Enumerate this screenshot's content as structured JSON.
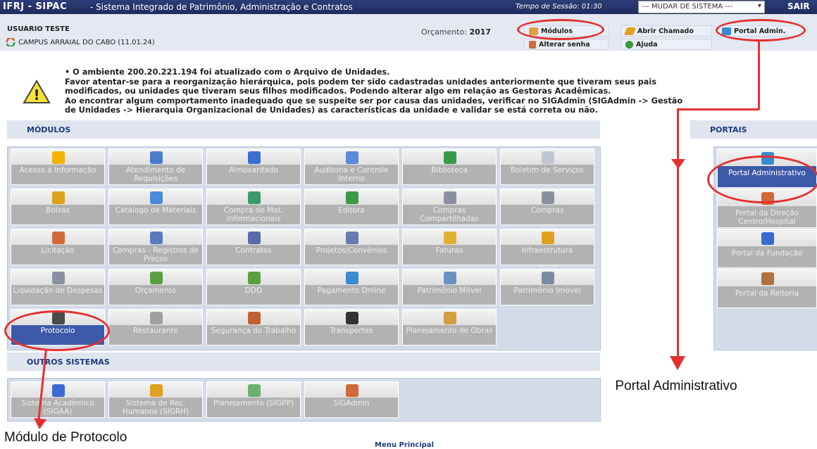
{
  "topbar": {
    "logo": "IFRJ - SIPAC",
    "description": "- Sistema Integrado de Patrimônio, Administração e Contratos",
    "session": "Tempo de Sessão: 01:30",
    "system_select": "--- MUDAR DE SISTEMA ---",
    "logout": "SAIR"
  },
  "info": {
    "user": "USUARIO TESTE",
    "campus": "CAMPUS ARRAIAL DO CABO (11.01.24)",
    "budget_label": "Orçamento:",
    "budget_year": "2017",
    "quick": {
      "modulos": "Módulos",
      "abrir_chamado": "Abrir Chamado",
      "portal_admin": "Portal Admin.",
      "alterar_senha": "Alterar senha",
      "ajuda": "Ajuda"
    }
  },
  "notice": {
    "line1": "• O ambiente 200.20.221.194 foi atualizado com o Arquivo de Unidades.",
    "line2": "Favor atentar-se para a reorganização hierárquica, pois podem ter sido cadastradas unidades anteriormente que tiveram seus pais",
    "line3": "modificados, ou unidades que tiveram seus filhos modificados. Podendo alterar algo em relação as Gestoras Acadêmicas.",
    "line4": "Ao encontrar algum comportamento inadequado que se suspeite ser por causa das unidades, verificar no SIGAdmin (SIGAdmin -> Gestão",
    "line5": "de Unidades -> Hierarquia Organizacional de Unidades) as características da unidade e validar se está correta ou não."
  },
  "sections": {
    "modulos": "MÓDULOS",
    "portais": "PORTAIS",
    "outros": "OUTROS SISTEMAS",
    "menu_principal": "Menu Principal"
  },
  "modules": [
    {
      "label": "Acesso à Informação",
      "icon": "info-icon",
      "color": "#f0b400"
    },
    {
      "label": "Atendimento de Requisições",
      "icon": "document-check-icon",
      "color": "#4a7ccc"
    },
    {
      "label": "Almoxarifado",
      "icon": "boxes-icon",
      "color": "#3a6fd0"
    },
    {
      "label": "Auditoria e Controle Interno",
      "icon": "magnifier-icon",
      "color": "#5a8ad8"
    },
    {
      "label": "Biblioteca",
      "icon": "books-icon",
      "color": "#3a9a4a"
    },
    {
      "label": "Boletim de Serviços",
      "icon": "bulletin-icon",
      "color": "#bfc6d0"
    },
    {
      "label": "Bolsas",
      "icon": "folder-icon",
      "color": "#d9a21a"
    },
    {
      "label": "Catálogo de Materiais",
      "icon": "catalog-icon",
      "color": "#4a8ad8"
    },
    {
      "label": "Compra de Mat. Informacionais",
      "icon": "books-cart-icon",
      "color": "#3a9a6a"
    },
    {
      "label": "Editora",
      "icon": "books-icon",
      "color": "#3a9a4a"
    },
    {
      "label": "Compras Compartilhadas",
      "icon": "cart-icon",
      "color": "#8a90a0"
    },
    {
      "label": "Compras",
      "icon": "cart-icon",
      "color": "#8a90a0"
    },
    {
      "label": "Licitação",
      "icon": "people-icon",
      "color": "#d06a3a"
    },
    {
      "label": "Compras - Registros de Preços",
      "icon": "register-icon",
      "color": "#5a7ac0"
    },
    {
      "label": "Contratos",
      "icon": "contract-icon",
      "color": "#5a6aa8"
    },
    {
      "label": "Projetos/Convênios",
      "icon": "handshake-icon",
      "color": "#6a7ab0"
    },
    {
      "label": "Faturas",
      "icon": "invoice-icon",
      "color": "#e0b030"
    },
    {
      "label": "Infraestrutura",
      "icon": "worker-icon",
      "color": "#e0a020"
    },
    {
      "label": "Liquidação de Despesas",
      "icon": "cart-icon",
      "color": "#8a90a0"
    },
    {
      "label": "Orçamento",
      "icon": "money-icon",
      "color": "#5aa040"
    },
    {
      "label": "DDO",
      "icon": "money-icon",
      "color": "#5aa040"
    },
    {
      "label": "Pagamento Online",
      "icon": "globe-pay-icon",
      "color": "#3a8ad0"
    },
    {
      "label": "Patrimônio Móvel",
      "icon": "furniture-icon",
      "color": "#6a90c0"
    },
    {
      "label": "Patrimônio Imóvel",
      "icon": "building-icon",
      "color": "#7a8aa0"
    },
    {
      "label": "Protocolo",
      "icon": "book-icon",
      "color": "#4a4a4a",
      "active": true
    },
    {
      "label": "Restaurante",
      "icon": "cup-icon",
      "color": "#a0a0a0"
    },
    {
      "label": "Segurança do Trabalho",
      "icon": "worker-icon",
      "color": "#c06030"
    },
    {
      "label": "Transportes",
      "icon": "tire-icon",
      "color": "#333333"
    },
    {
      "label": "Planejamento de Obras",
      "icon": "planning-icon",
      "color": "#d0a040"
    }
  ],
  "portals": [
    {
      "label": "Portal Administrativo",
      "icon": "portal-network-icon",
      "color": "#3a8ad0",
      "active": true
    },
    {
      "label": "Portal da Direção Centro/Hospital",
      "icon": "people-icon",
      "color": "#d06a3a"
    },
    {
      "label": "Portal da Fundação",
      "icon": "globe-icon",
      "color": "#3a6ad0"
    },
    {
      "label": "Portal da Reitoria",
      "icon": "person-icon",
      "color": "#b07040"
    }
  ],
  "other_systems": [
    {
      "label": "Sistema Acadêmico (SIGAA)",
      "icon": "book-stack-icon",
      "color": "#3a6ad0"
    },
    {
      "label": "Sistema de Rec. Humanos (SIGRH)",
      "icon": "person-icon",
      "color": "#e0a020"
    },
    {
      "label": "Planejamento (SIGPP)",
      "icon": "grid-chart-icon",
      "color": "#6ab070"
    },
    {
      "label": "SIGAdmin",
      "icon": "admin-users-icon",
      "color": "#d06a3a"
    }
  ],
  "annotations": {
    "portal": "Portal Administrativo",
    "protocolo": "Módulo de Protocolo"
  }
}
